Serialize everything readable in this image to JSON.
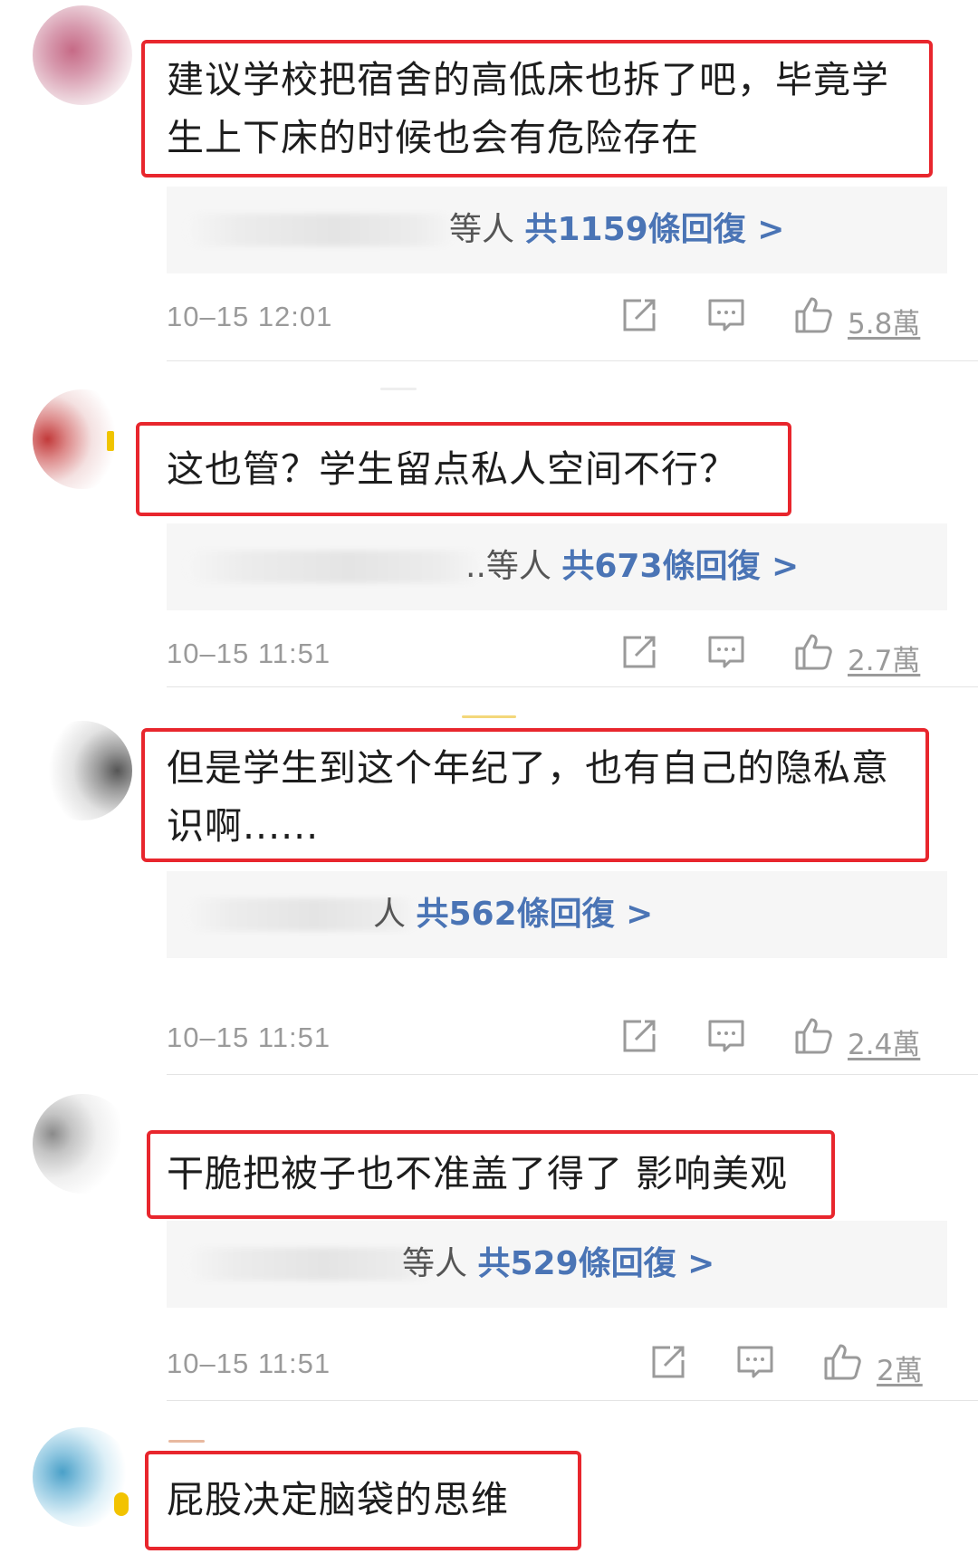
{
  "comments": [
    {
      "text": "建议学校把宿舍的高低床也拆了吧，毕竟学\n生上下床的时候也会有危险存在",
      "reply_who": "等人",
      "reply_count": "共1159條回復 >",
      "timestamp": "10–15 12:01",
      "likes": "5.8萬"
    },
    {
      "text": "这也管？学生留点私人空间不行？",
      "reply_who": "..等人",
      "reply_count": "共673條回復 >",
      "timestamp": "10–15 11:51",
      "likes": "2.7萬"
    },
    {
      "text": "但是学生到这个年纪了，也有自己的隐私意\n识啊......",
      "reply_who": "人",
      "reply_count": "共562條回復 >",
      "timestamp": "10–15 11:51",
      "likes": "2.4萬"
    },
    {
      "text": "干脆把被子也不准盖了得了 影响美观",
      "reply_who": "等人",
      "reply_count": "共529條回復 >",
      "timestamp": "10–15 11:51",
      "likes": "2萬"
    },
    {
      "text": "屁股决定脑袋的思维"
    }
  ],
  "icons": {
    "share": "share-icon",
    "comment": "comment-icon",
    "like": "thumbs-up-icon"
  },
  "colors": {
    "highlight_border": "#e8262d",
    "reply_link": "#4a74b5",
    "meta_gray": "#9a9a9a",
    "reply_background": "#f6f6f6"
  }
}
